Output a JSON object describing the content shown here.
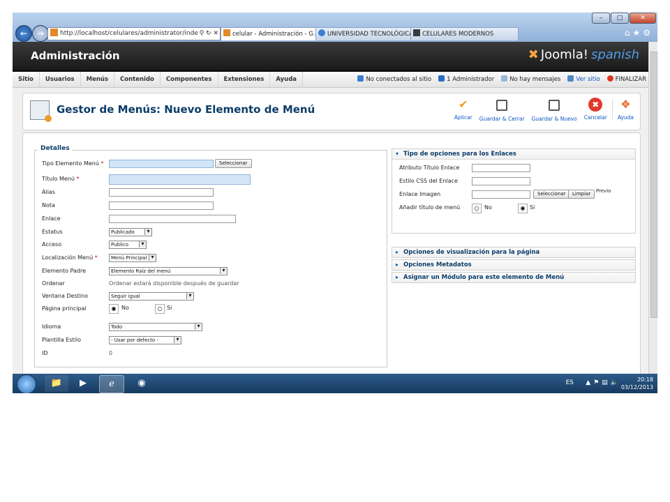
{
  "browser": {
    "address": "http://localhost/celulares/administrator/index.p",
    "address_host": "localhost",
    "tabs": [
      {
        "label": "celular - Administración - G...",
        "close": "×"
      },
      {
        "label": "UNIVERSIDAD TECNOLÓGICA ..."
      },
      {
        "label": "CELULARES MODERNOS"
      }
    ],
    "window_controls": [
      "–",
      "□",
      "✕"
    ]
  },
  "header": {
    "title": "Administración",
    "logo_main": "Joomla!",
    "logo_sub": "spanish"
  },
  "menu": {
    "items": [
      "Sitio",
      "Usuarios",
      "Menús",
      "Contenido",
      "Componentes",
      "Extensiones",
      "Ayuda"
    ],
    "status": {
      "not_connected": "No conectados al sitio",
      "admins": "1 Administrador",
      "messages": "No hay mensajes",
      "view_site": "Ver sitio",
      "logout": "FINALIZAR"
    }
  },
  "toolbar": {
    "page_title": "Gestor de Menús: Nuevo Elemento de Menú",
    "apply": "Aplicar",
    "save_close": "Guardar & Cerrar",
    "save_new": "Guardar & Nuevo",
    "cancel": "Cancelar",
    "help": "Ayuda"
  },
  "details": {
    "legend": "Detalles",
    "tipo_elemento": {
      "label": "Tipo Elemento Menú",
      "button": "Seleccionar"
    },
    "titulo_menu": {
      "label": "Título Menú"
    },
    "alias": {
      "label": "Alias"
    },
    "nota": {
      "label": "Nota"
    },
    "enlace": {
      "label": "Enlace"
    },
    "estatus": {
      "label": "Estatus",
      "value": "Publicado"
    },
    "acceso": {
      "label": "Acceso",
      "value": "Publico"
    },
    "localizacion": {
      "label": "Localización Menú",
      "value": "Menú Principal"
    },
    "elemento_padre": {
      "label": "Elemento Padre",
      "value": "Elemento Raíz del menú"
    },
    "ordenar": {
      "label": "Ordenar",
      "value": "Ordenar estará disponible después de guardar"
    },
    "ventana": {
      "label": "Ventana Destino",
      "value": "Seguir igual"
    },
    "pagina_principal": {
      "label": "Página principal",
      "no": "No",
      "si": "Si"
    },
    "idioma": {
      "label": "Idioma",
      "value": "Todo"
    },
    "plantilla": {
      "label": "Plantilla Estilo",
      "value": "- Usar por defecto -"
    },
    "id": {
      "label": "ID",
      "value": "0"
    },
    "required_mark": "*"
  },
  "right_panels": {
    "links": {
      "title": "Tipo de opciones para los Enlaces",
      "atributo": "Atributo Título Enlace",
      "estilo": "Estilo CSS del Enlace",
      "imagen": "Enlace Imagen",
      "select_btn": "Seleccionar",
      "clear_btn": "Limpiar",
      "preview": "Previo",
      "add_title": "Añadir título de menú",
      "no": "No",
      "si": "Si"
    },
    "collapsed": [
      "Opciones de visualización para la página",
      "Opciones Metadatos",
      "Asignar un Módulo para este elemento de Menú"
    ]
  },
  "taskbar": {
    "lang": "ES",
    "time": "20:18",
    "date": "03/12/2013"
  },
  "colors": {
    "title_blue": "#0b3d6a",
    "link_blue": "#0b55c4",
    "required_field": "#d2e6f8",
    "header_dark": "#1a1a1a"
  }
}
